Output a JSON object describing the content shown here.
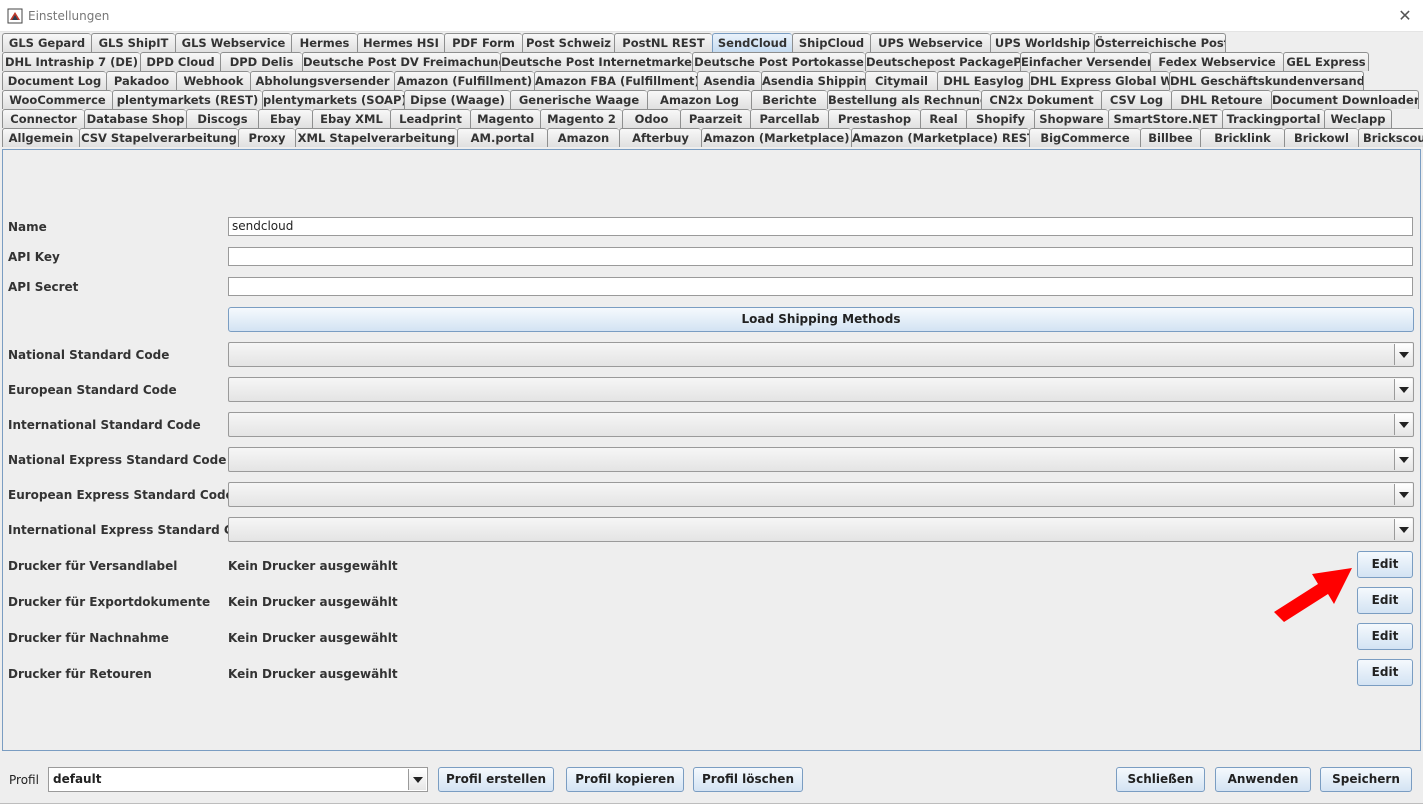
{
  "window": {
    "title": "Einstellungen",
    "close_glyph": "✕"
  },
  "tabs": {
    "selected": "SendCloud",
    "rows": [
      [
        "GLS Gepard",
        "GLS ShipIT",
        "GLS Webservice",
        "Hermes",
        "Hermes HSI",
        "PDF Form",
        "Post Schweiz",
        "PostNL REST",
        "SendCloud",
        "ShipCloud",
        "UPS Webservice",
        "UPS Worldship",
        "Österreichische Post"
      ],
      [
        "DHL Intraship 7 (DE)",
        "DPD Cloud",
        "DPD Delis",
        "Deutsche Post DV Freimachung",
        "Deutsche Post Internetmarke",
        "Deutsche Post Portokasse",
        "Deutschepost PackagePlus",
        "Einfacher Versender",
        "Fedex Webservice",
        "GEL Express"
      ],
      [
        "Document Log",
        "Pakadoo",
        "Webhook",
        "Abholungsversender",
        "Amazon (Fulfillment)",
        "Amazon FBA (Fulfillment)",
        "Asendia",
        "Asendia Shipping",
        "Citymail",
        "DHL Easylog",
        "DHL Express Global WS",
        "DHL Geschäftskundenversand"
      ],
      [
        "WooCommerce",
        "plentymarkets (REST)",
        "plentymarkets (SOAP)",
        "Dipse (Waage)",
        "Generische Waage",
        "Amazon Log",
        "Berichte",
        "Bestellung als Rechnung",
        "CN2x Dokument",
        "CSV Log",
        "DHL Retoure",
        "Document Downloader"
      ],
      [
        "Connector",
        "Database Shop",
        "Discogs",
        "Ebay",
        "Ebay XML",
        "Leadprint",
        "Magento",
        "Magento 2",
        "Odoo",
        "Paarzeit",
        "Parcellab",
        "Prestashop",
        "Real",
        "Shopify",
        "Shopware",
        "SmartStore.NET",
        "Trackingportal",
        "Weclapp"
      ],
      [
        "Allgemein",
        "CSV Stapelverarbeitung",
        "Proxy",
        "XML Stapelverarbeitung",
        "AM.portal",
        "Amazon",
        "Afterbuy",
        "Amazon (Marketplace)",
        "Amazon (Marketplace) REST",
        "BigCommerce",
        "Billbee",
        "Bricklink",
        "Brickowl",
        "Brickscout"
      ]
    ]
  },
  "form": {
    "name_label": "Name",
    "name_value": "sendcloud",
    "api_key_label": "API Key",
    "api_key_value": "",
    "api_secret_label": "API Secret",
    "api_secret_value": "",
    "load_button": "Load Shipping Methods",
    "combos": [
      {
        "label": "National Standard Code",
        "value": ""
      },
      {
        "label": "European Standard Code",
        "value": ""
      },
      {
        "label": "International Standard Code",
        "value": ""
      },
      {
        "label": "National Express Standard Code",
        "value": ""
      },
      {
        "label": "European Express Standard Code",
        "value": ""
      },
      {
        "label": "International Express Standard Code",
        "value": ""
      }
    ],
    "printers": [
      {
        "label": "Drucker für Versandlabel",
        "value": "Kein Drucker ausgewählt",
        "button": "Edit"
      },
      {
        "label": "Drucker für Exportdokumente",
        "value": "Kein Drucker ausgewählt",
        "button": "Edit"
      },
      {
        "label": "Drucker für Nachnahme",
        "value": "Kein Drucker ausgewählt",
        "button": "Edit"
      },
      {
        "label": "Drucker für Retouren",
        "value": "Kein Drucker ausgewählt",
        "button": "Edit"
      }
    ]
  },
  "footer": {
    "profile_label": "Profil",
    "profile_value": "default",
    "create_button": "Profil erstellen",
    "copy_button": "Profil kopieren",
    "delete_button": "Profil löschen",
    "close_button": "Schließen",
    "apply_button": "Anwenden",
    "save_button": "Speichern"
  },
  "colors": {
    "selected_tab": "#c6dcf1",
    "annotation_arrow": "#ff0000",
    "panel_border": "#7a9dc2"
  },
  "icons": {
    "app": "java-app-icon",
    "close": "close-icon",
    "dropdown": "chevron-down-icon",
    "annotation": "red-arrow-annotation"
  }
}
